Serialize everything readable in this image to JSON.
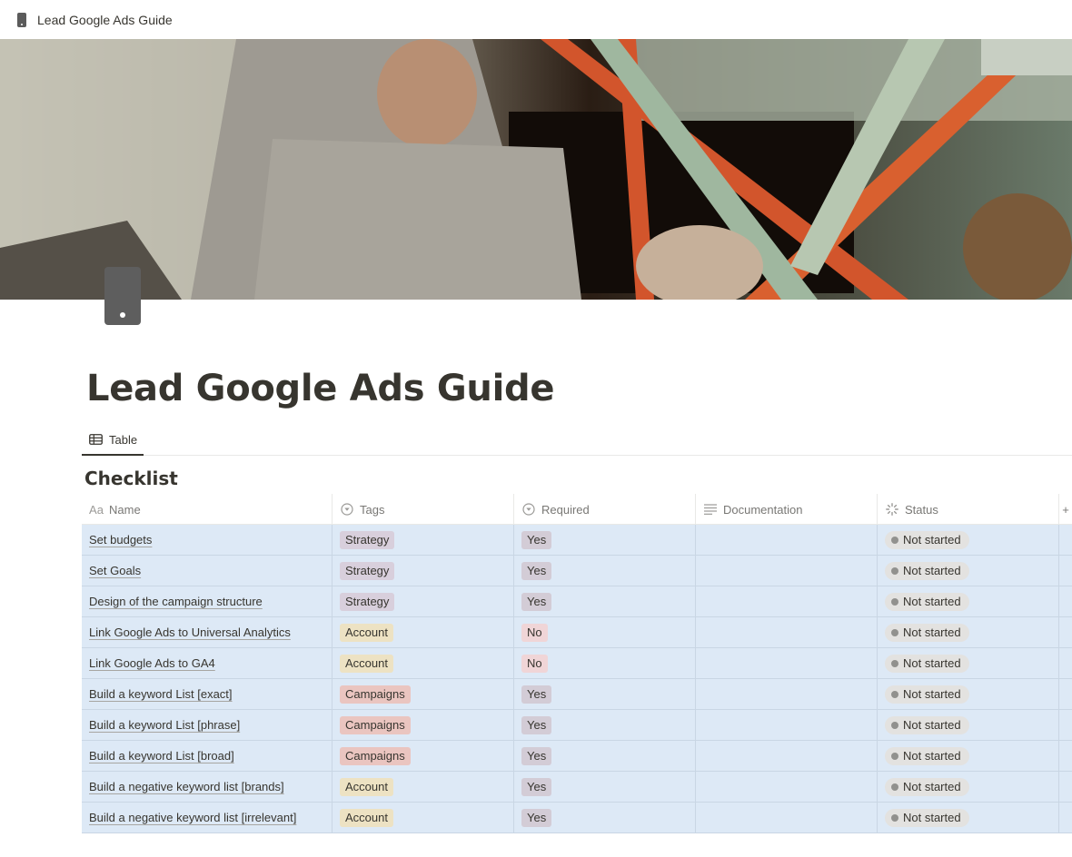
{
  "topbar": {
    "title": "Lead Google Ads Guide",
    "icon": "phone-icon"
  },
  "page": {
    "title": "Lead Google Ads Guide"
  },
  "views": [
    {
      "label": "Table",
      "icon": "table-icon"
    }
  ],
  "database": {
    "title": "Checklist",
    "columns": [
      {
        "key": "name",
        "label": "Name",
        "icon": "Aa"
      },
      {
        "key": "tags",
        "label": "Tags",
        "icon": "select-icon"
      },
      {
        "key": "required",
        "label": "Required",
        "icon": "select-icon"
      },
      {
        "key": "documentation",
        "label": "Documentation",
        "icon": "text-icon"
      },
      {
        "key": "status",
        "label": "Status",
        "icon": "status-icon"
      }
    ],
    "more_column": "+",
    "rows": [
      {
        "name": "Set budgets",
        "tags": "Strategy",
        "required": "Yes",
        "documentation": "",
        "status": "Not started"
      },
      {
        "name": "Set Goals",
        "tags": "Strategy",
        "required": "Yes",
        "documentation": "",
        "status": "Not started"
      },
      {
        "name": "Design of the campaign structure",
        "tags": "Strategy",
        "required": "Yes",
        "documentation": "",
        "status": "Not started"
      },
      {
        "name": "Link Google Ads to Universal Analytics",
        "tags": "Account",
        "required": "No",
        "documentation": "",
        "status": "Not started"
      },
      {
        "name": "Link Google Ads to GA4",
        "tags": "Account",
        "required": "No",
        "documentation": "",
        "status": "Not started"
      },
      {
        "name": "Build a keyword List [exact]",
        "tags": "Campaigns",
        "required": "Yes",
        "documentation": "",
        "status": "Not started"
      },
      {
        "name": "Build a keyword List [phrase]",
        "tags": "Campaigns",
        "required": "Yes",
        "documentation": "",
        "status": "Not started"
      },
      {
        "name": "Build a keyword List [broad]",
        "tags": "Campaigns",
        "required": "Yes",
        "documentation": "",
        "status": "Not started"
      },
      {
        "name": "Build a negative keyword list [brands]",
        "tags": "Account",
        "required": "Yes",
        "documentation": "",
        "status": "Not started"
      },
      {
        "name": "Build a negative keyword list [irrelevant]",
        "tags": "Account",
        "required": "Yes",
        "documentation": "",
        "status": "Not started"
      }
    ]
  },
  "colors": {
    "tag_Strategy": "#d8cfdc",
    "tag_Account": "#ede2c3",
    "tag_Campaigns": "#eac5c0",
    "req_Yes": "#d3ccd6",
    "req_No": "#f0d5d7",
    "row_selected": "#dde9f6"
  }
}
